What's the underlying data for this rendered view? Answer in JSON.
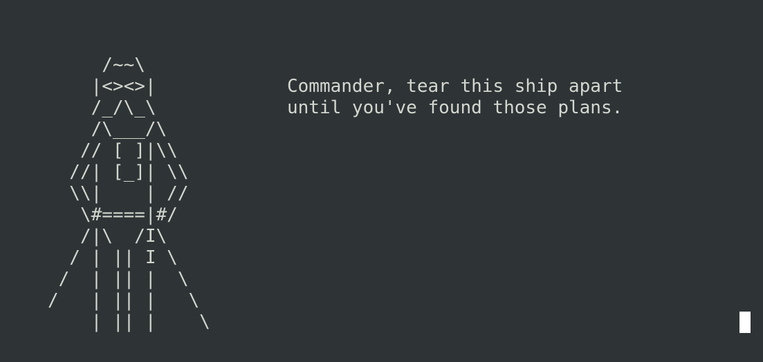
{
  "terminal": {
    "art_lines": [
      "     /~~\\",
      "    |<><>|",
      "    /_/\\_\\",
      "    /\\___/\\",
      "   // [ ]|\\\\",
      "  //| [_]| \\\\",
      "  \\\\|    | //",
      "   \\#====|#/",
      "   /|\\  /I\\",
      "  / | || I \\",
      " /  | || |  \\",
      "/   | || |   \\",
      "    | || |    \\"
    ],
    "message_lines": [
      "Commander, tear this ship apart",
      "until you've found those plans."
    ]
  },
  "colors": {
    "background": "#2e3436",
    "foreground": "#d3d7cf",
    "cursor": "#ffffff"
  }
}
